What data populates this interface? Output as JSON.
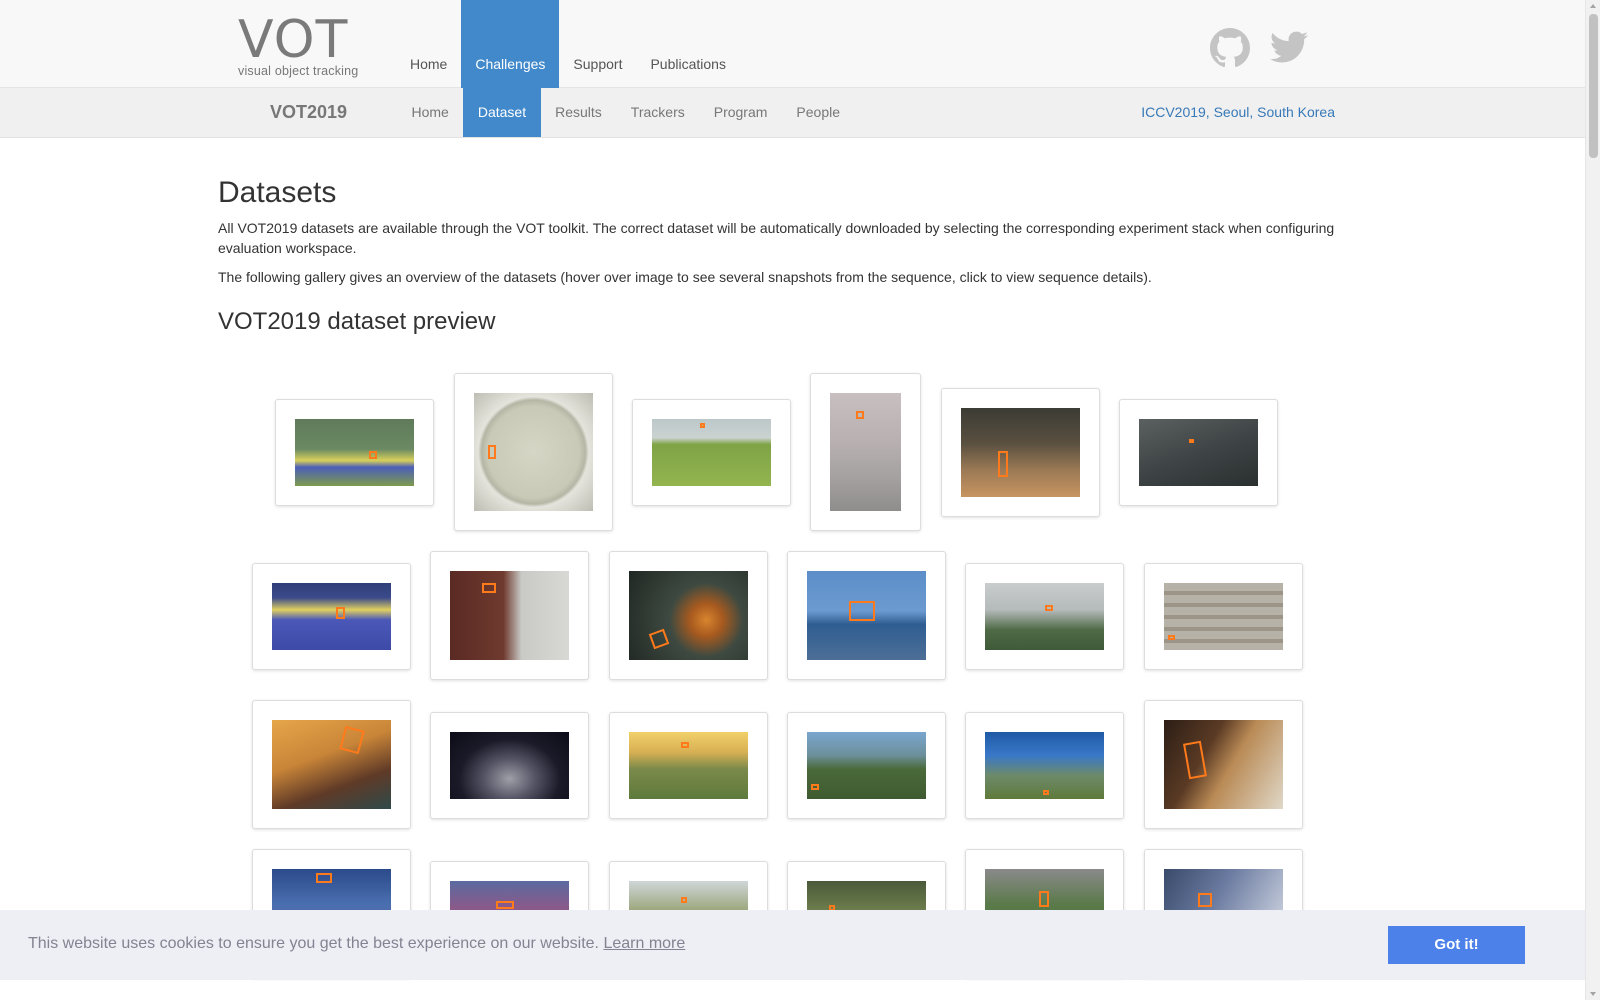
{
  "logo": {
    "text": "VOT",
    "subtitle": "visual object tracking"
  },
  "main_nav": [
    {
      "label": "Home"
    },
    {
      "label": "Challenges",
      "active": true
    },
    {
      "label": "Support"
    },
    {
      "label": "Publications"
    }
  ],
  "social": {
    "github": "github-icon",
    "twitter": "twitter-icon"
  },
  "sub_nav": {
    "brand": "VOT2019",
    "items": [
      {
        "label": "Home"
      },
      {
        "label": "Dataset",
        "active": true
      },
      {
        "label": "Results"
      },
      {
        "label": "Trackers"
      },
      {
        "label": "Program"
      },
      {
        "label": "People"
      }
    ],
    "event": "ICCV2019, Seoul, South Korea"
  },
  "page": {
    "title": "Datasets",
    "intro": "All VOT2019 datasets are available through the VOT toolkit. The correct dataset will be automatically downloaded by selecting the corresponding experiment stack when configuring evaluation workspace.",
    "gallery_note": "The following gallery gives an overview of the datasets (hover over image to see several snapshots from the sequence, click to view sequence details).",
    "section_title": "VOT2019 dataset preview"
  },
  "cookie": {
    "message": "This website uses cookies to ensure you get the best experience on our website.",
    "learn_more": "Learn more",
    "button": "Got it!"
  },
  "colors": {
    "accent": "#4189cb",
    "cookie_button": "#4b81e8",
    "bbox": "#ff7a1a"
  }
}
